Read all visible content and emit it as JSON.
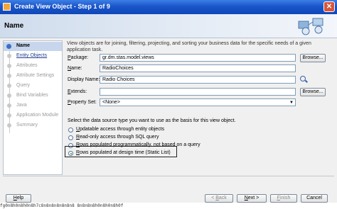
{
  "window": {
    "title": "Create View Object - Step 1 of 9"
  },
  "header": {
    "title": "Name"
  },
  "nav": {
    "items": [
      {
        "label": "Name",
        "state": "active"
      },
      {
        "label": "Entity Objects",
        "state": "link"
      },
      {
        "label": "Attributes",
        "state": "disabled"
      },
      {
        "label": "Attribute Settings",
        "state": "disabled"
      },
      {
        "label": "Query",
        "state": "disabled"
      },
      {
        "label": "Bind Variables",
        "state": "disabled"
      },
      {
        "label": "Java",
        "state": "disabled"
      },
      {
        "label": "Application Module",
        "state": "disabled"
      },
      {
        "label": "Summary",
        "state": "disabled"
      }
    ]
  },
  "form": {
    "description": "View objects are for joining, filtering, projecting, and sorting your business data for the specific needs of a given application task.",
    "package": {
      "label_u": "P",
      "label_rest": "ackage:",
      "value": "gr.dm.stas.model.views",
      "browse": "Browse..."
    },
    "name": {
      "label_u": "N",
      "label_rest": "ame:",
      "value": "RadioChoices"
    },
    "display_name": {
      "label": "Display Name:",
      "value": "Radio Choices"
    },
    "extends": {
      "label_u": "E",
      "label_rest": "xtends:",
      "value": "",
      "browse": "Browse..."
    },
    "property_set": {
      "label_u": "P",
      "label_rest": "roperty Set:",
      "value": "<None>"
    },
    "source_prompt": "Select the data source type you want to use as the basis for this view object.",
    "options": [
      {
        "u": "U",
        "rest": "pdatable access through entity objects",
        "checked": false
      },
      {
        "u": "R",
        "rest": "ead-only access through SQL query",
        "checked": false
      },
      {
        "u": "R",
        "rest": "ows populated programmatically, not based on a query",
        "checked": false
      },
      {
        "u": "R",
        "rest": "ows populated at design time (Static List)",
        "checked": true
      }
    ]
  },
  "footer": {
    "help": "Help",
    "back": "< Back",
    "next": "Next >",
    "finish": "Finish",
    "cancel": "Cancel"
  },
  "status_text": "fg0n8h0n8h0n8h7c8n8n8n8n8n8n8  8n8n8n8h0n8h0n8h0f"
}
